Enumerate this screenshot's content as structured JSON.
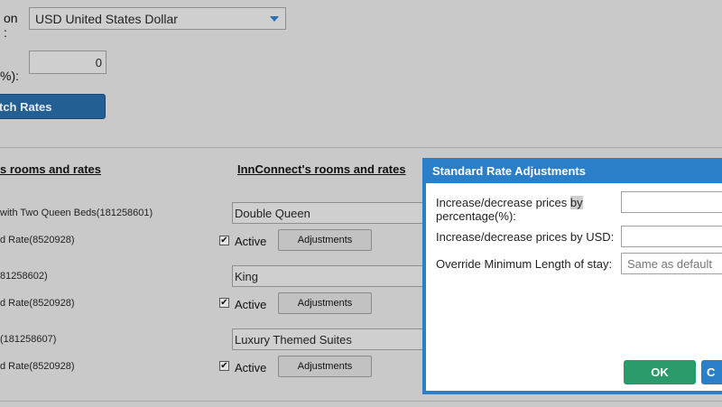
{
  "form": {
    "currency_label_line1": "on",
    "currency_label_line2": ":",
    "currency_value": "USD United States Dollar",
    "pct_label": "%):",
    "pct_value": "0",
    "fetch_label": "tch Rates"
  },
  "headers": {
    "left": "s rooms and rates",
    "right": "InnConnect's rooms and rates"
  },
  "rows": [
    {
      "room": "with Two Queen Beds(181258601)",
      "rate": "d Rate(8520928)",
      "match": "Double Queen",
      "active": "Active",
      "adj": "Adjustments",
      "checked": "✔"
    },
    {
      "room": "81258602)",
      "rate": "d Rate(8520928)",
      "match": "King",
      "active": "Active",
      "adj": "Adjustments",
      "checked": "✔"
    },
    {
      "room": "(181258607)",
      "rate": "d Rate(8520928)",
      "match": "Luxury Themed Suites",
      "active": "Active",
      "adj": "Adjustments",
      "checked": "✔"
    }
  ],
  "dialog": {
    "title": "Standard Rate Adjustments",
    "pct_label_a": "Increase/decrease prices ",
    "pct_label_hl": "by",
    "pct_label_b": "percentage(%):",
    "usd_label": "Increase/decrease prices by USD:",
    "minlos_label": "Override Minimum Length of stay:",
    "minlos_value": "Same as default",
    "ok_label": "OK",
    "cancel_label": "C"
  }
}
